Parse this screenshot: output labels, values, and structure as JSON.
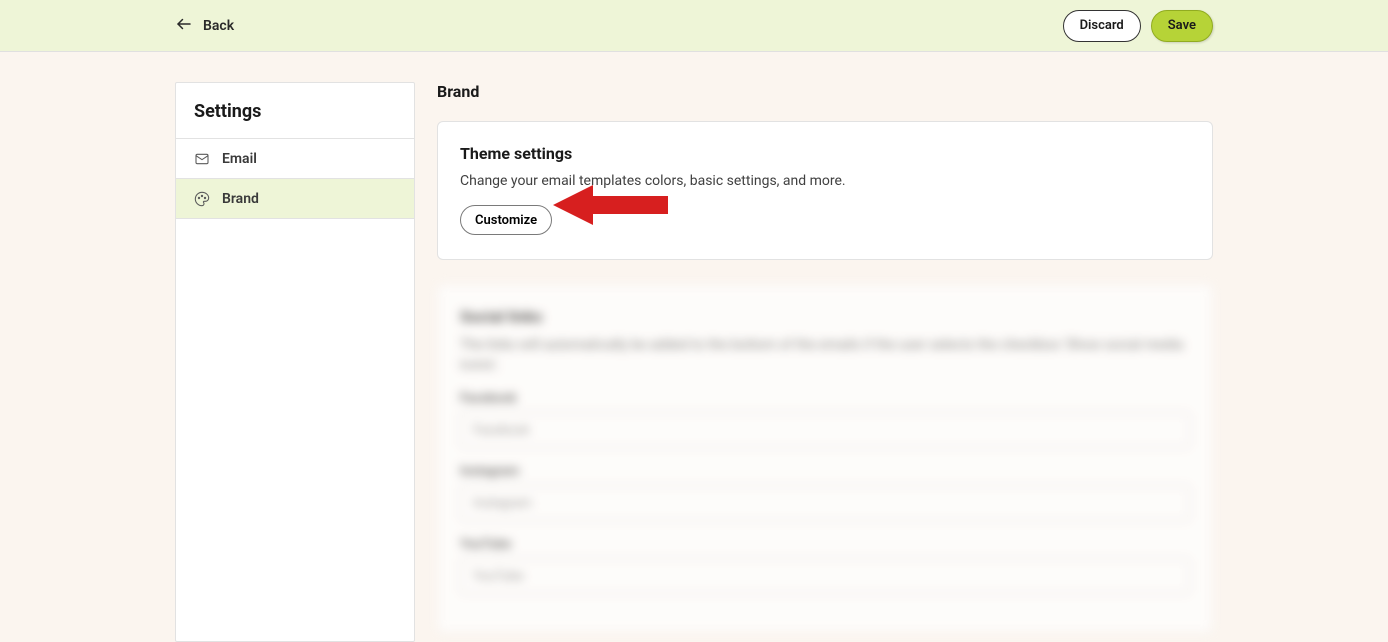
{
  "topbar": {
    "back_label": "Back",
    "discard_label": "Discard",
    "save_label": "Save"
  },
  "sidebar": {
    "title": "Settings",
    "items": [
      {
        "label": "Email",
        "icon": "envelope-icon",
        "active": false
      },
      {
        "label": "Brand",
        "icon": "palette-icon",
        "active": true
      }
    ]
  },
  "main": {
    "page_title": "Brand",
    "theme_card": {
      "heading": "Theme settings",
      "description": "Change your email templates colors, basic settings, and more.",
      "customize_label": "Customize"
    },
    "social_card": {
      "heading": "Social links",
      "description": "The links will automatically be added to the bottom of the emails if the user selects the checkbox 'Show social media icons'.",
      "fields": [
        {
          "label": "Facebook",
          "placeholder": "Facebook"
        },
        {
          "label": "Instagram",
          "placeholder": "Instagram"
        },
        {
          "label": "YouTube",
          "placeholder": "YouTube"
        }
      ]
    }
  },
  "annotation": {
    "arrow_color": "#d71f1f"
  }
}
